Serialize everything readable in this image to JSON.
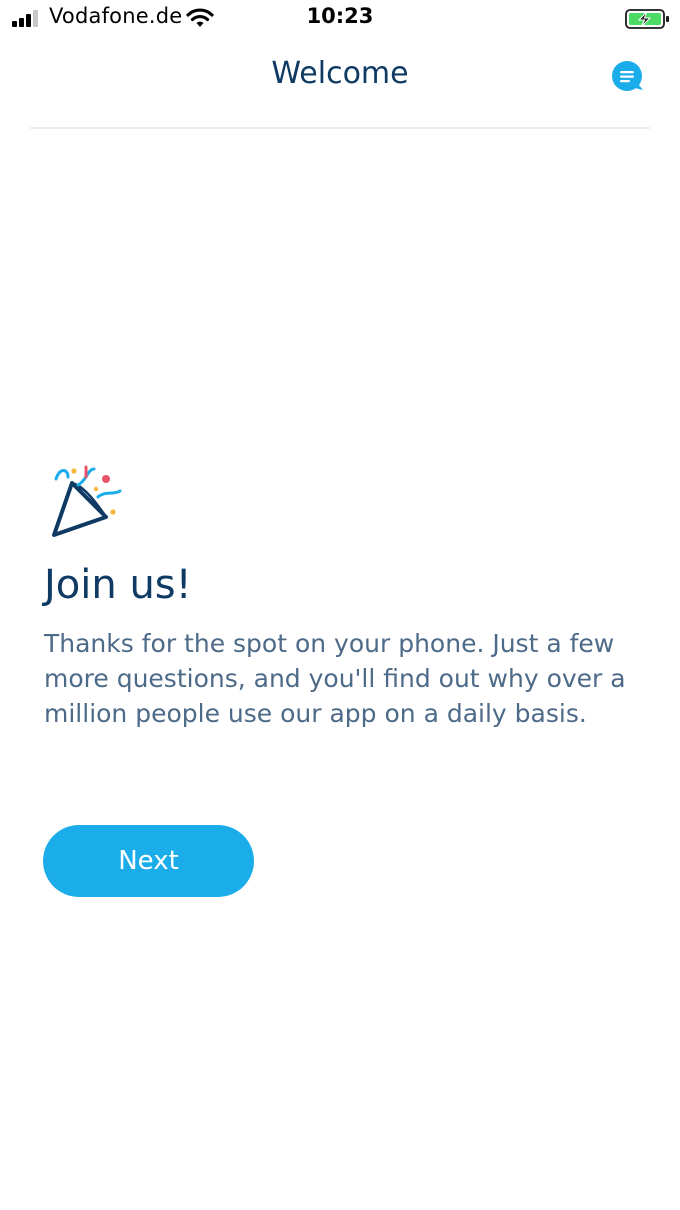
{
  "status_bar": {
    "carrier": "Vodafone.de",
    "time": "10:23",
    "icons": [
      "signal-icon",
      "wifi-icon",
      "battery-charging-icon"
    ]
  },
  "nav": {
    "title": "Welcome",
    "chat_icon": "chat-bubble-icon"
  },
  "content": {
    "icon": "party-popper-icon",
    "heading": "Join us!",
    "body": "Thanks for the spot on your phone. Just a few more questions, and you'll find out why over a million people use our app on a daily basis.",
    "next_label": "Next"
  },
  "colors": {
    "accent": "#1badea",
    "title": "#0f3a63",
    "body_text": "#4d6a88",
    "battery": "#4cd964"
  }
}
